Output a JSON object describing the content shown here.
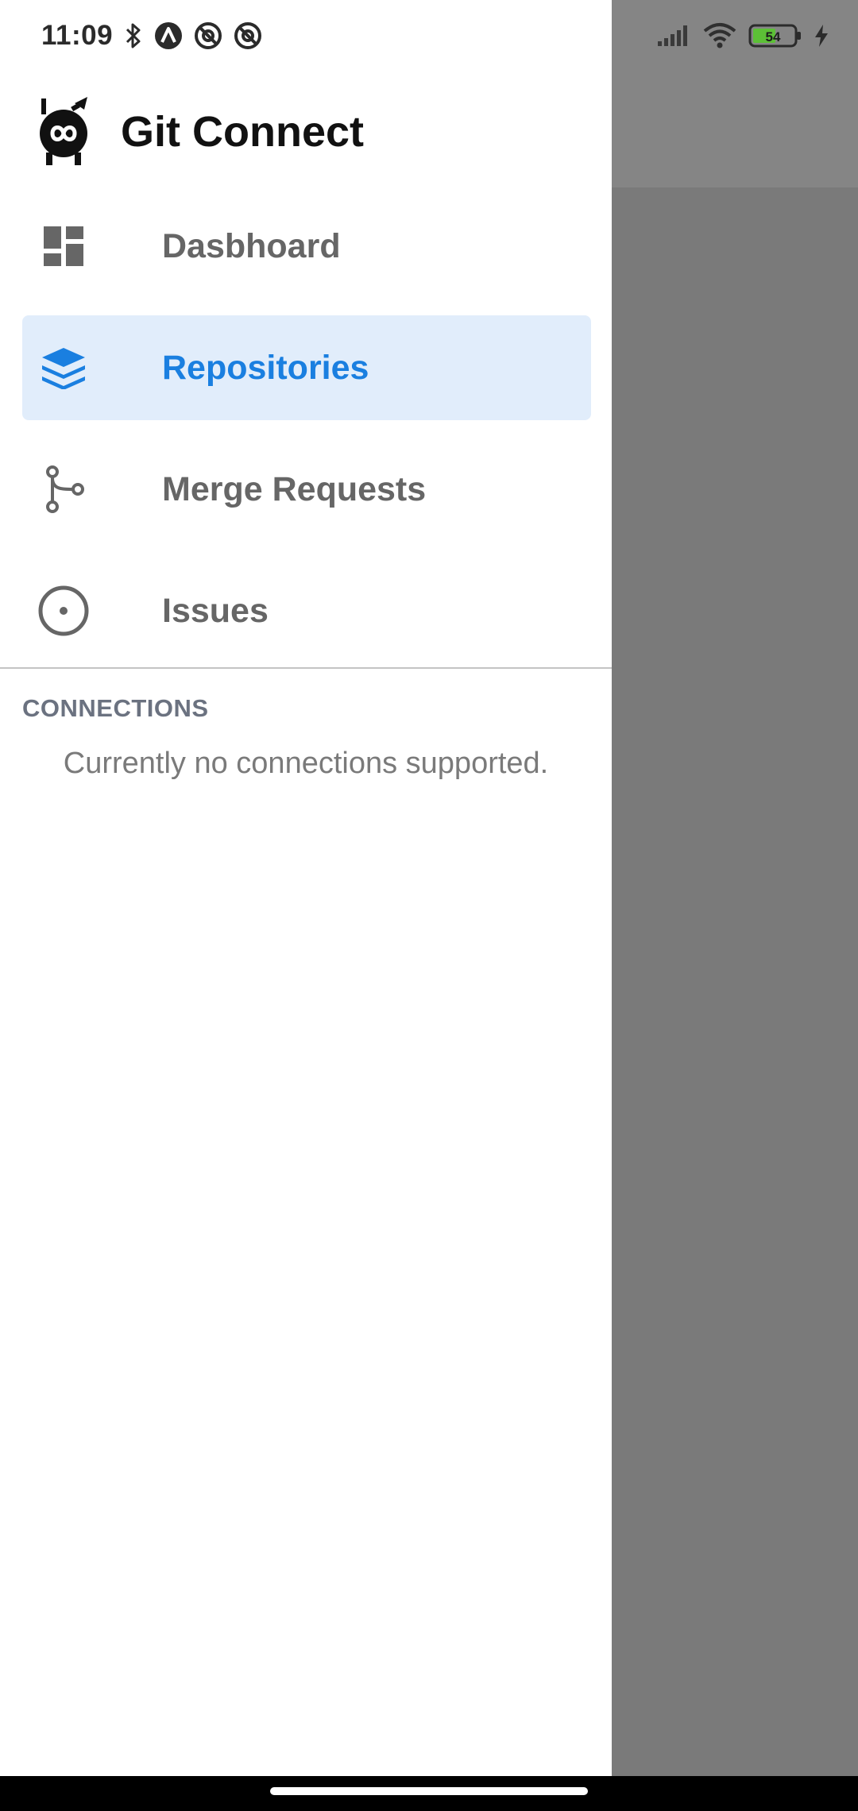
{
  "status_bar": {
    "time": "11:09",
    "left_icons": [
      "bluetooth-icon",
      "app-notification-icon",
      "at-sign-icon",
      "at-sign-icon"
    ],
    "battery_level": "54",
    "right_icons": [
      "signal-icon",
      "wifi-icon",
      "battery-icon",
      "charging-icon"
    ],
    "battery_color": "#5cc036"
  },
  "header": {
    "app_title": "Git Connect",
    "logo_icon": "git-connect-logo"
  },
  "nav": {
    "items": [
      {
        "label": "Dasbhoard",
        "icon": "dashboard-icon",
        "active": false
      },
      {
        "label": "Repositories",
        "icon": "layers-icon",
        "active": true
      },
      {
        "label": "Merge Requests",
        "icon": "merge-icon",
        "active": false
      },
      {
        "label": "Issues",
        "icon": "issue-circle-icon",
        "active": false
      }
    ]
  },
  "connections": {
    "header": "CONNECTIONS",
    "empty_message": "Currently no connections supported."
  },
  "colors": {
    "accent": "#1a7fe0",
    "active_background": "#e1edfb",
    "inactive_text": "#666666",
    "scrim": "#7a7a7a"
  }
}
